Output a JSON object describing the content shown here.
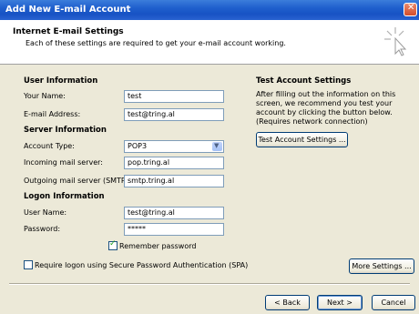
{
  "window": {
    "title": "Add New E-mail Account"
  },
  "header": {
    "title": "Internet E-mail Settings",
    "subtitle": "Each of these settings are required to get your e-mail account working."
  },
  "user_info": {
    "section_title": "User Information",
    "name_label": "Your Name:",
    "name_value": "test",
    "email_label": "E-mail Address:",
    "email_value": "test@tring.al"
  },
  "server_info": {
    "section_title": "Server Information",
    "account_type_label": "Account Type:",
    "account_type_value": "POP3",
    "incoming_label": "Incoming mail server:",
    "incoming_value": "pop.tring.al",
    "outgoing_label": "Outgoing mail server (SMTP):",
    "outgoing_value": "smtp.tring.al"
  },
  "logon_info": {
    "section_title": "Logon Information",
    "username_label": "User Name:",
    "username_value": "test@tring.al",
    "password_label": "Password:",
    "password_value": "*****",
    "remember_label": "Remember password",
    "remember_checked": true,
    "spa_label": "Require logon using Secure Password Authentication (SPA)",
    "spa_checked": false
  },
  "test_settings": {
    "section_title": "Test Account Settings",
    "description": "After filling out the information on this screen, we recommend you test your account by clicking the button below. (Requires network connection)",
    "button_label": "Test Account Settings ..."
  },
  "buttons": {
    "more_settings": "More Settings ...",
    "back": "< Back",
    "next": "Next >",
    "cancel": "Cancel"
  }
}
